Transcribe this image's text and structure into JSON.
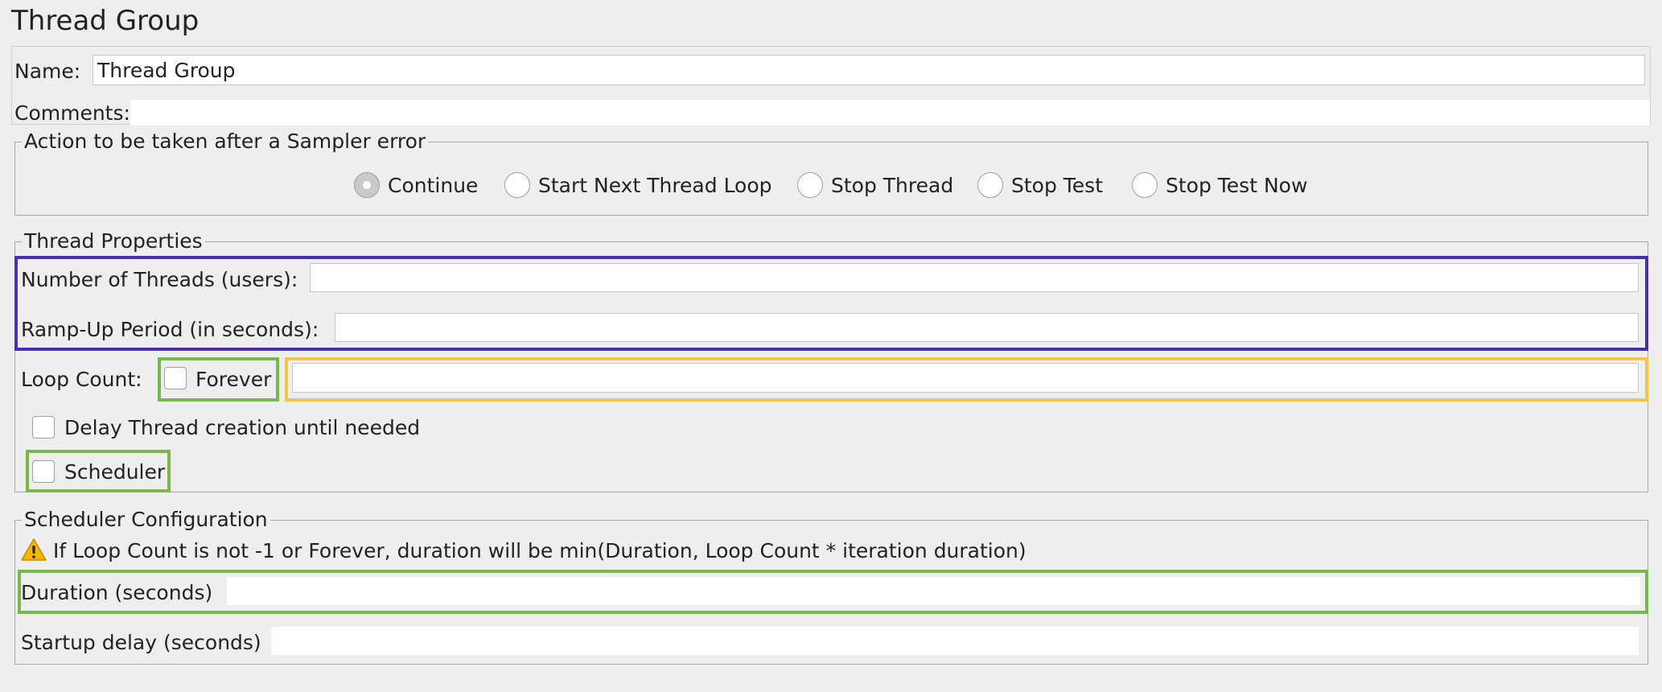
{
  "page": {
    "title": "Thread Group"
  },
  "name_section": {
    "name_label": "Name:",
    "name_value": "Thread Group",
    "comments_label": "Comments:",
    "comments_value": ""
  },
  "sampler_error": {
    "legend": "Action to be taken after a Sampler error",
    "options": [
      {
        "label": "Continue",
        "selected": true
      },
      {
        "label": "Start Next Thread Loop",
        "selected": false
      },
      {
        "label": "Stop Thread",
        "selected": false
      },
      {
        "label": "Stop Test",
        "selected": false
      },
      {
        "label": "Stop Test Now",
        "selected": false
      }
    ]
  },
  "thread_properties": {
    "legend": "Thread Properties",
    "num_threads_label": "Number of Threads (users):",
    "num_threads_value": "",
    "ramp_up_label": "Ramp-Up Period (in seconds):",
    "ramp_up_value": "",
    "loop_count_label": "Loop Count:",
    "forever_label": "Forever",
    "forever_checked": false,
    "loop_count_value": "",
    "delay_creation_label": "Delay Thread creation until needed",
    "delay_creation_checked": false,
    "scheduler_label": "Scheduler",
    "scheduler_checked": false
  },
  "scheduler_config": {
    "legend": "Scheduler Configuration",
    "warning_icon": "warning-triangle-icon",
    "warning_text": "If Loop Count is not -1 or Forever, duration will be min(Duration, Loop Count * iteration duration)",
    "duration_label": "Duration (seconds)",
    "duration_value": "",
    "startup_delay_label": "Startup delay (seconds)",
    "startup_delay_value": ""
  },
  "colors": {
    "background": "#eeeeee",
    "highlight_purple": "#4a2db5",
    "highlight_green": "#76b84a",
    "highlight_yellow": "#f5c54a",
    "warning_yellow": "#f5b800"
  }
}
